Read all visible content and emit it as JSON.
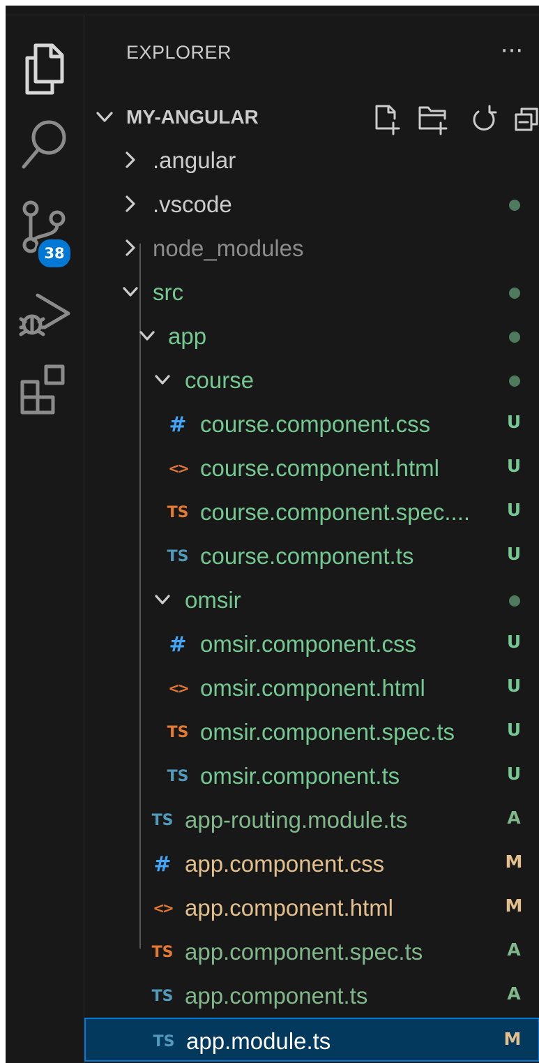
{
  "activity_bar": {
    "items": [
      {
        "name": "explorer-icon",
        "active": true
      },
      {
        "name": "search-icon",
        "active": false
      },
      {
        "name": "source-control-icon",
        "active": false,
        "badge": "38"
      },
      {
        "name": "run-debug-icon",
        "active": false
      },
      {
        "name": "extensions-icon",
        "active": false
      }
    ],
    "badge_color": "#0078d4"
  },
  "explorer": {
    "title": "EXPLORER",
    "more_label": "···",
    "section_title": "MY-ANGULAR",
    "toolbar": [
      "new-file-icon",
      "new-folder-icon",
      "refresh-icon",
      "collapse-all-icon"
    ]
  },
  "colors": {
    "untracked": "#73c991",
    "modified": "#e2c08d",
    "added": "#81b88b",
    "ignored": "#8c8c8c",
    "default": "#cccccc",
    "dot": "#4f7a5e",
    "selection": "#04395e",
    "ts_blue": "#519aba",
    "ts_orange": "#e37933",
    "html_orange": "#e37933",
    "css_blue": "#42a5f5"
  },
  "tree": [
    {
      "label": ".angular",
      "type": "folder",
      "expanded": false,
      "depth": 0,
      "color": "default",
      "deco": ""
    },
    {
      "label": ".vscode",
      "type": "folder",
      "expanded": false,
      "depth": 0,
      "color": "default",
      "deco": "dot"
    },
    {
      "label": "node_modules",
      "type": "folder",
      "expanded": false,
      "depth": 0,
      "color": "ignored",
      "deco": ""
    },
    {
      "label": "src",
      "type": "folder",
      "expanded": true,
      "depth": 0,
      "color": "untracked",
      "deco": "dot"
    },
    {
      "label": "app",
      "type": "folder",
      "expanded": true,
      "depth": 1,
      "color": "untracked",
      "deco": "dot"
    },
    {
      "label": "course",
      "type": "folder",
      "expanded": true,
      "depth": 2,
      "color": "untracked",
      "deco": "dot"
    },
    {
      "label": "course.component.css",
      "type": "file",
      "icon": "css-file-icon",
      "depth": 3,
      "color": "untracked",
      "deco": "U"
    },
    {
      "label": "course.component.html",
      "type": "file",
      "icon": "html-file-icon",
      "depth": 3,
      "color": "untracked",
      "deco": "U"
    },
    {
      "label": "course.component.spec....",
      "type": "file",
      "icon": "ts-spec-file-icon",
      "depth": 3,
      "color": "untracked",
      "deco": "U"
    },
    {
      "label": "course.component.ts",
      "type": "file",
      "icon": "ts-file-icon",
      "depth": 3,
      "color": "untracked",
      "deco": "U"
    },
    {
      "label": "omsir",
      "type": "folder",
      "expanded": true,
      "depth": 2,
      "color": "untracked",
      "deco": "dot"
    },
    {
      "label": "omsir.component.css",
      "type": "file",
      "icon": "css-file-icon",
      "depth": 3,
      "color": "untracked",
      "deco": "U"
    },
    {
      "label": "omsir.component.html",
      "type": "file",
      "icon": "html-file-icon",
      "depth": 3,
      "color": "untracked",
      "deco": "U"
    },
    {
      "label": "omsir.component.spec.ts",
      "type": "file",
      "icon": "ts-spec-file-icon",
      "depth": 3,
      "color": "untracked",
      "deco": "U"
    },
    {
      "label": "omsir.component.ts",
      "type": "file",
      "icon": "ts-file-icon",
      "depth": 3,
      "color": "untracked",
      "deco": "U"
    },
    {
      "label": "app-routing.module.ts",
      "type": "file",
      "icon": "ts-file-icon",
      "depth": 2,
      "color": "added",
      "deco": "A"
    },
    {
      "label": "app.component.css",
      "type": "file",
      "icon": "css-file-icon",
      "depth": 2,
      "color": "modified",
      "deco": "M"
    },
    {
      "label": "app.component.html",
      "type": "file",
      "icon": "html-file-icon",
      "depth": 2,
      "color": "modified",
      "deco": "M"
    },
    {
      "label": "app.component.spec.ts",
      "type": "file",
      "icon": "ts-spec-file-icon",
      "depth": 2,
      "color": "added",
      "deco": "A"
    },
    {
      "label": "app.component.ts",
      "type": "file",
      "icon": "ts-file-icon",
      "depth": 2,
      "color": "added",
      "deco": "A"
    },
    {
      "label": "app.module.ts",
      "type": "file",
      "icon": "ts-file-icon",
      "depth": 2,
      "color": "modified",
      "deco": "M",
      "selected": true
    }
  ]
}
